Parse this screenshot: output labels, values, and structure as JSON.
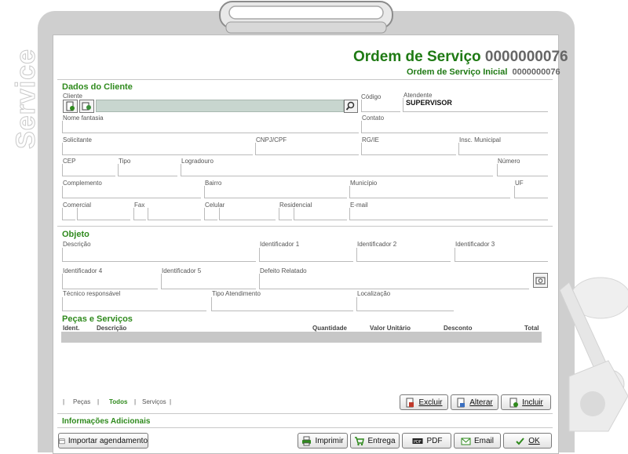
{
  "side_label": "Service",
  "header": {
    "title": "Ordem de Serviço",
    "number": "0000000076",
    "subtitle": "Ordem de Serviço Inicial",
    "subnumber": "0000000076"
  },
  "cliente": {
    "section_title": "Dados do Cliente",
    "labels": {
      "cliente": "Cliente",
      "codigo": "Código",
      "atendente": "Atendente",
      "nome_fantasia": "Nome fantasia",
      "contato": "Contato",
      "solicitante": "Solicitante",
      "cnpj": "CNPJ/CPF",
      "rg": "RG/IE",
      "insc_municipal": "Insc. Municipal",
      "cep": "CEP",
      "tipo": "Tipo",
      "logradouro": "Logradouro",
      "numero": "Número",
      "complemento": "Complemento",
      "bairro": "Bairro",
      "municipio": "Município",
      "uf": "UF",
      "comercial": "Comercial",
      "fax": "Fax",
      "celular": "Celular",
      "residencial": "Residencial",
      "email": "E-mail"
    },
    "values": {
      "atendente": "SUPERVISOR"
    }
  },
  "objeto": {
    "section_title": "Objeto",
    "labels": {
      "descricao": "Descrição",
      "id1": "Identificador 1",
      "id2": "Identificador 2",
      "id3": "Identificador 3",
      "id4": "Identificador 4",
      "id5": "Identificador 5",
      "defeito": "Defeito Relatado",
      "tecnico": "Técnico responsável",
      "tipo_atendimento": "Tipo Atendimento",
      "localizacao": "Localização"
    }
  },
  "pecas": {
    "section_title": "Peças e Serviços",
    "columns": [
      "Ident.",
      "Descrição",
      "Quantidade",
      "Valor Unitário",
      "Desconto",
      "Total"
    ],
    "filters": [
      "Peças",
      "Todos",
      "Serviços"
    ],
    "selected_filter": "Todos",
    "buttons": {
      "excluir": "Excluir",
      "alterar": "Alterar",
      "incluir": "Incluir"
    }
  },
  "info": {
    "section_title": "Informações Adicionais"
  },
  "footer": {
    "importar": "Importar agendamento",
    "imprimir": "Imprimir",
    "entrega": "Entrega",
    "pdf": "PDF",
    "email": "Email",
    "ok": "OK"
  },
  "colors": {
    "accent_green": "#2f8a1d",
    "title_green": "#1f7a14",
    "number_gray": "#666666",
    "client_field_bg": "#c8d6cf",
    "grid_header_bg": "#c7c7c7"
  }
}
